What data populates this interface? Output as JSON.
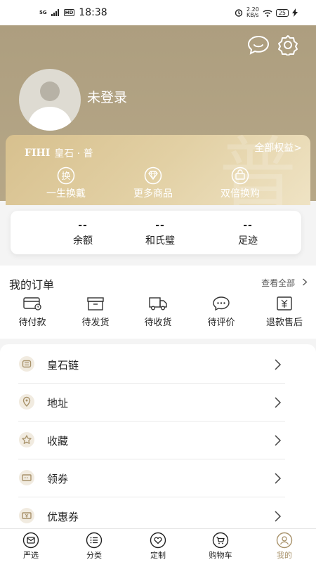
{
  "status_bar": {
    "network": "5G",
    "hd": "HD",
    "time": "18:38",
    "speed": "2.20\nKB/s",
    "battery": "25"
  },
  "header": {
    "login_text": "未登录"
  },
  "member_card": {
    "brand": "皇石 · 普",
    "logo": "FIHI",
    "all_benefits": "全部权益>",
    "benefits": [
      {
        "icon": "exchange-icon",
        "glyph": "换",
        "label": "一生换戴"
      },
      {
        "icon": "diamond-icon",
        "label": "更多商品"
      },
      {
        "icon": "double-exchange-icon",
        "label": "双倍换购"
      }
    ],
    "watermark": "普"
  },
  "stats": [
    {
      "value": "--",
      "label": "余额"
    },
    {
      "value": "--",
      "label": "和氏璧"
    },
    {
      "value": "--",
      "label": "足迹"
    }
  ],
  "orders": {
    "title": "我的订单",
    "view_all": "查看全部",
    "items": [
      {
        "icon": "wallet-icon",
        "label": "待付款"
      },
      {
        "icon": "box-icon",
        "label": "待发货"
      },
      {
        "icon": "truck-icon",
        "label": "待收货"
      },
      {
        "icon": "comment-icon",
        "label": "待评价"
      },
      {
        "icon": "refund-icon",
        "label": "退款售后"
      }
    ]
  },
  "menu": [
    {
      "icon": "chain-icon",
      "label": "皇石链"
    },
    {
      "icon": "location-icon",
      "label": "地址"
    },
    {
      "icon": "star-icon",
      "label": "收藏"
    },
    {
      "icon": "coupon-icon",
      "label": "领券"
    },
    {
      "icon": "voucher-icon",
      "label": "优惠券"
    }
  ],
  "tabbar": {
    "items": [
      {
        "icon": "mail-icon",
        "label": "严选"
      },
      {
        "icon": "list-icon",
        "label": "分类"
      },
      {
        "icon": "heart-icon",
        "label": "定制"
      },
      {
        "icon": "cart-icon",
        "label": "购物车"
      },
      {
        "icon": "user-icon",
        "label": "我的"
      }
    ],
    "active": "我的"
  },
  "colors": {
    "header_bg": "#ad9e7f",
    "card_gold": "#d7c08e",
    "active_tab": "#a8926a"
  }
}
